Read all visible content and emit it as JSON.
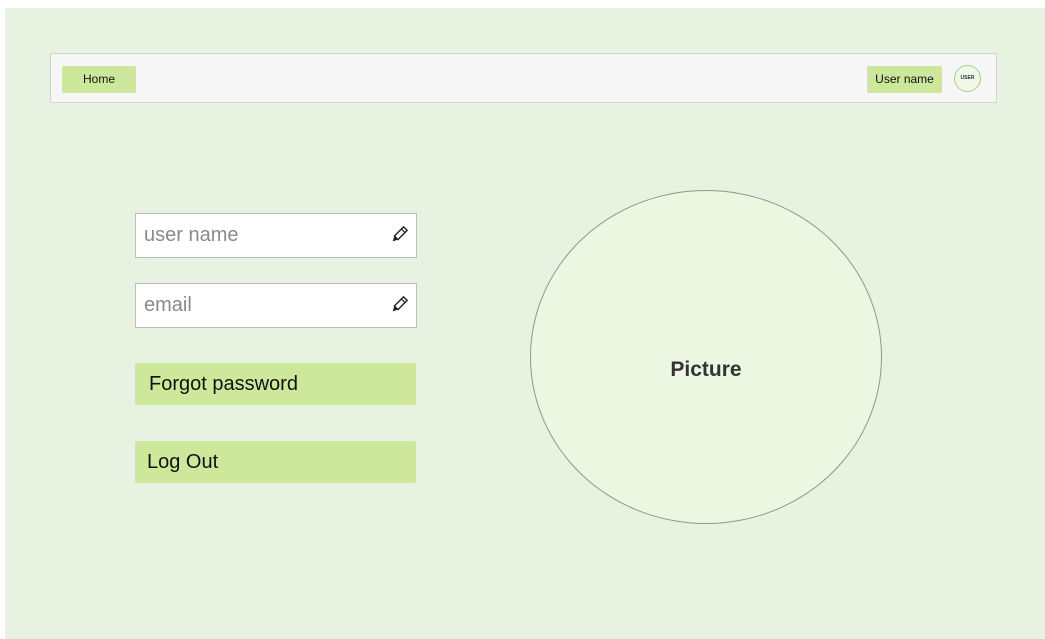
{
  "nav": {
    "home_label": "Home",
    "user_label": "User name",
    "avatar_text": "USER"
  },
  "form": {
    "username_placeholder": "user name",
    "email_placeholder": "email",
    "edit_icon": "pencil-icon",
    "forgot_password_label": "Forgot password",
    "logout_label": "Log Out"
  },
  "picture": {
    "label": "Picture"
  },
  "colors": {
    "background": "#e8f2e1",
    "accent": "#cde89a",
    "picture_fill": "#ecf7e2"
  }
}
